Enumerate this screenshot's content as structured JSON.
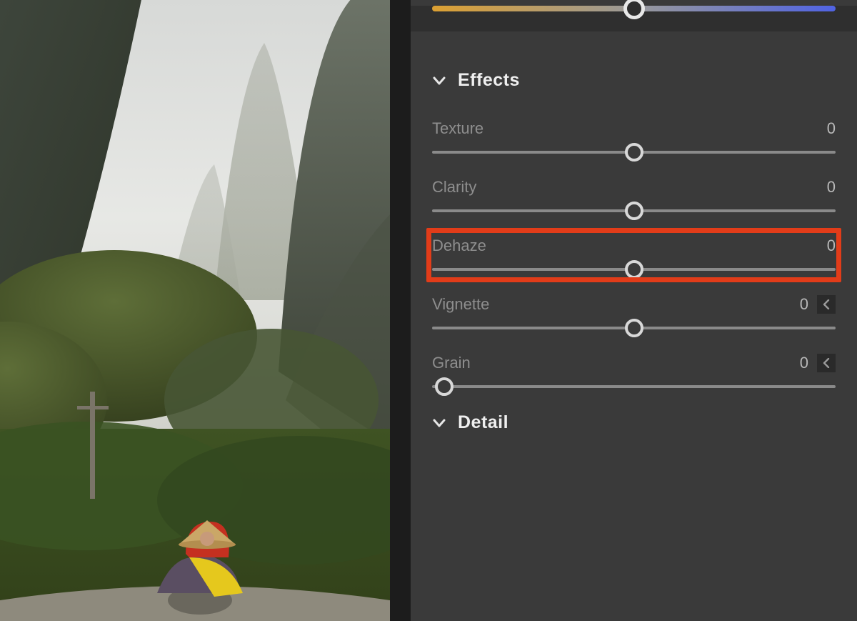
{
  "top_slider": {
    "position_percent": 50
  },
  "sections": {
    "effects": {
      "title": "Effects",
      "sliders": [
        {
          "key": "texture",
          "label": "Texture",
          "value": 0,
          "thumb_percent": 50,
          "disclosure": false
        },
        {
          "key": "clarity",
          "label": "Clarity",
          "value": 0,
          "thumb_percent": 50,
          "disclosure": false
        },
        {
          "key": "dehaze",
          "label": "Dehaze",
          "value": 0,
          "thumb_percent": 50,
          "disclosure": false
        },
        {
          "key": "vignette",
          "label": "Vignette",
          "value": 0,
          "thumb_percent": 50,
          "disclosure": true
        },
        {
          "key": "grain",
          "label": "Grain",
          "value": 0,
          "thumb_percent": 3,
          "disclosure": true
        }
      ]
    },
    "detail": {
      "title": "Detail"
    }
  },
  "annotation": {
    "highlighted_slider_key": "dehaze",
    "highlight_color": "#e23c19"
  }
}
